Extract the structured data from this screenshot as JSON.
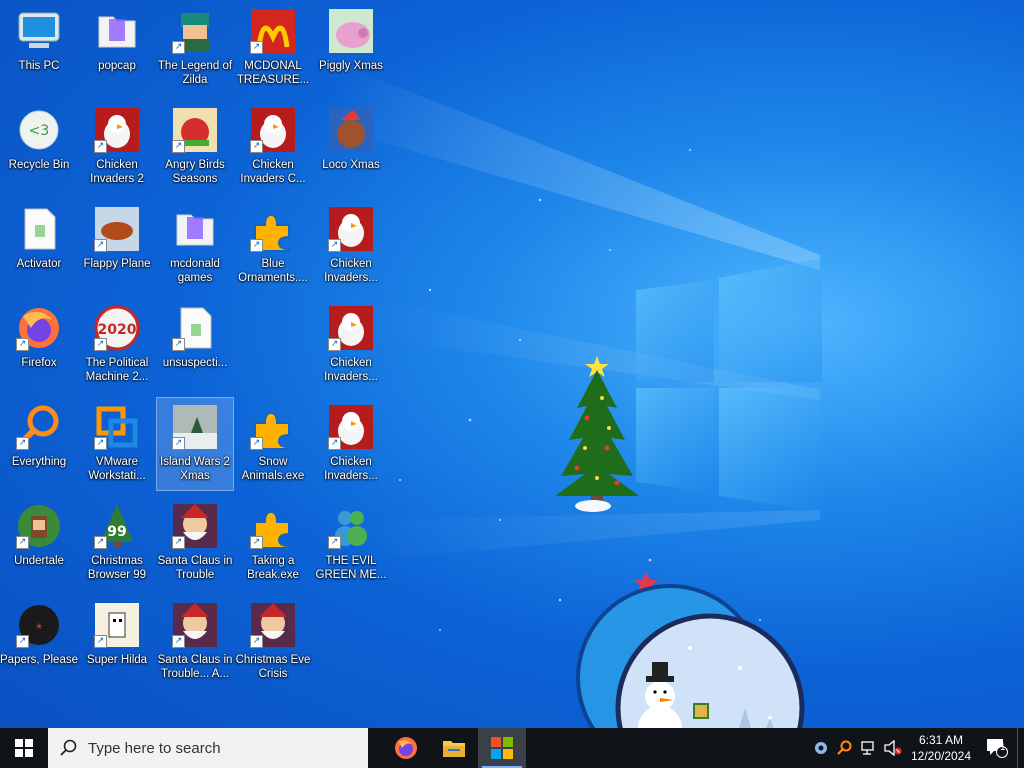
{
  "desktop": {
    "icons": [
      {
        "label": "This PC",
        "shortcut": false,
        "icon": "this-pc-icon"
      },
      {
        "label": "popcap",
        "shortcut": false,
        "icon": "folder-icon"
      },
      {
        "label": "The Legend of Zilda",
        "shortcut": true,
        "icon": "legend-of-zilda-icon"
      },
      {
        "label": "MCDONAL TREASURE...",
        "shortcut": true,
        "icon": "mcdonald-icon"
      },
      {
        "label": "Piggly Xmas",
        "shortcut": false,
        "icon": "piggly-xmas-icon"
      },
      {
        "label": "Recycle Bin",
        "shortcut": false,
        "icon": "recycle-bin-icon"
      },
      {
        "label": "Chicken Invaders 2",
        "shortcut": true,
        "icon": "chicken-invaders-icon"
      },
      {
        "label": "Angry Birds Seasons",
        "shortcut": true,
        "icon": "angry-birds-icon"
      },
      {
        "label": "Chicken Invaders C...",
        "shortcut": true,
        "icon": "chicken-invaders-icon"
      },
      {
        "label": "Loco Xmas",
        "shortcut": false,
        "icon": "loco-xmas-icon"
      },
      {
        "label": "Activator",
        "shortcut": false,
        "icon": "file-icon"
      },
      {
        "label": "Flappy Plane",
        "shortcut": true,
        "icon": "flappy-plane-icon"
      },
      {
        "label": "mcdonald games",
        "shortcut": false,
        "icon": "folder-icon"
      },
      {
        "label": "Blue Ornaments....",
        "shortcut": true,
        "icon": "puzzle-icon"
      },
      {
        "label": "Chicken Invaders...",
        "shortcut": true,
        "icon": "chicken-invaders-icon"
      },
      {
        "label": "Firefox",
        "shortcut": true,
        "icon": "firefox-icon"
      },
      {
        "label": "The Political Machine 2...",
        "shortcut": true,
        "icon": "political-machine-icon"
      },
      {
        "label": "unsuspecti...",
        "shortcut": true,
        "icon": "file-icon"
      },
      {
        "label": "",
        "shortcut": false,
        "icon": ""
      },
      {
        "label": "Chicken Invaders...",
        "shortcut": true,
        "icon": "chicken-invaders-icon"
      },
      {
        "label": "Everything",
        "shortcut": true,
        "icon": "everything-search-icon"
      },
      {
        "label": "VMware Workstati...",
        "shortcut": true,
        "icon": "vmware-icon"
      },
      {
        "label": "Island Wars 2 Xmas",
        "shortcut": true,
        "icon": "island-wars-icon"
      },
      {
        "label": "Snow Animals.exe",
        "shortcut": true,
        "icon": "puzzle-icon"
      },
      {
        "label": "Chicken Invaders...",
        "shortcut": true,
        "icon": "chicken-invaders-icon"
      },
      {
        "label": "Undertale",
        "shortcut": true,
        "icon": "undertale-icon"
      },
      {
        "label": "Christmas Browser 99",
        "shortcut": true,
        "icon": "christmas-tree-icon"
      },
      {
        "label": "Santa Claus in Trouble",
        "shortcut": true,
        "icon": "santa-icon"
      },
      {
        "label": "Taking a Break.exe",
        "shortcut": true,
        "icon": "puzzle-icon"
      },
      {
        "label": "THE EVIL GREEN ME...",
        "shortcut": true,
        "icon": "messenger-icon"
      },
      {
        "label": "Papers, Please",
        "shortcut": true,
        "icon": "papers-please-icon"
      },
      {
        "label": "Super Hilda",
        "shortcut": true,
        "icon": "super-hilda-icon"
      },
      {
        "label": "Santa Claus in Trouble... A...",
        "shortcut": true,
        "icon": "santa-icon"
      },
      {
        "label": "Christmas Eve Crisis",
        "shortcut": true,
        "icon": "santa-icon"
      }
    ],
    "selected_label": "Island Wars 2 Xmas"
  },
  "taskbar": {
    "search_placeholder": "Type here to search",
    "apps": [
      {
        "name": "firefox-taskbar",
        "icon": "firefox-icon",
        "active": false
      },
      {
        "name": "file-explorer-taskbar",
        "icon": "folder-icon",
        "active": false
      },
      {
        "name": "app-taskbar",
        "icon": "app-grid-icon",
        "active": true
      }
    ],
    "tray": {
      "time": "6:31 AM",
      "date": "12/20/2024",
      "notification_count": "1"
    }
  }
}
